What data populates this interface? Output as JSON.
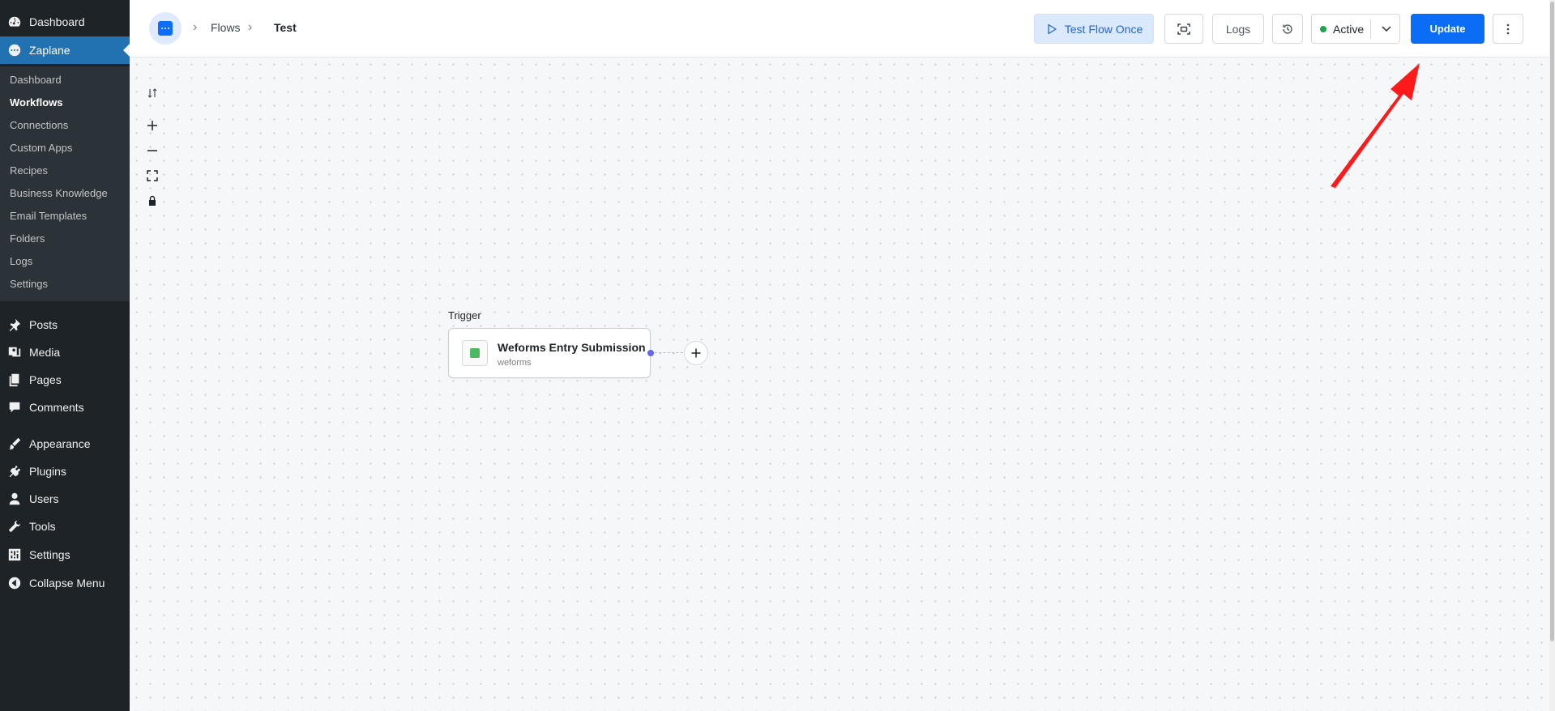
{
  "sidebar": {
    "top_items": [
      {
        "label": "Dashboard",
        "icon": "dashboard-icon"
      },
      {
        "label": "Zaplane",
        "icon": "zaplane-icon"
      }
    ],
    "submenu": [
      "Dashboard",
      "Workflows",
      "Connections",
      "Custom Apps",
      "Recipes",
      "Business Knowledge",
      "Email Templates",
      "Folders",
      "Logs",
      "Settings"
    ],
    "submenu_active": "Workflows",
    "items": [
      {
        "label": "Posts",
        "icon": "pin-icon"
      },
      {
        "label": "Media",
        "icon": "media-icon"
      },
      {
        "label": "Pages",
        "icon": "pages-icon"
      },
      {
        "label": "Comments",
        "icon": "comment-icon"
      },
      {
        "label": "Appearance",
        "icon": "brush-icon"
      },
      {
        "label": "Plugins",
        "icon": "plugin-icon"
      },
      {
        "label": "Users",
        "icon": "user-icon"
      },
      {
        "label": "Tools",
        "icon": "wrench-icon"
      },
      {
        "label": "Settings",
        "icon": "settings-icon"
      },
      {
        "label": "Collapse Menu",
        "icon": "collapse-icon"
      }
    ]
  },
  "header": {
    "breadcrumb": [
      "Flows",
      "Test"
    ],
    "test_flow_label": "Test Flow Once",
    "logs_label": "Logs",
    "status_label": "Active",
    "update_label": "Update"
  },
  "canvas": {
    "trigger_label": "Trigger",
    "node": {
      "title": "Weforms Entry Submission",
      "subtitle": "weforms"
    }
  },
  "colors": {
    "accent": "#0b6cf5",
    "sidebar_bg": "#1d2327",
    "wp_active": "#2271b1",
    "status_active": "#1ea44a",
    "annotation_arrow": "#ff1a1a"
  }
}
